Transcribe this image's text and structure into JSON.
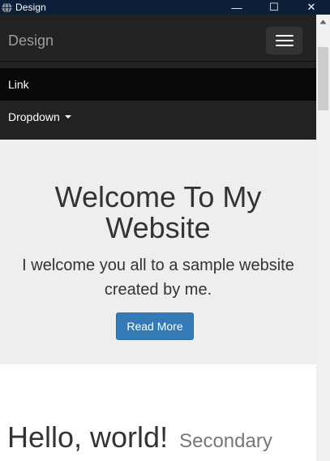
{
  "window": {
    "title": "Design",
    "controls": {
      "minimize": "—",
      "maximize": "☐",
      "close": "✕"
    }
  },
  "navbar": {
    "brand": "Design",
    "items": [
      {
        "label": "Link"
      },
      {
        "label": "Dropdown"
      }
    ]
  },
  "jumbotron": {
    "title": "Welcome To My Website",
    "text": "I welcome you all to a sample website created by me.",
    "button_label": "Read More"
  },
  "content": {
    "heading": "Hello, world!",
    "secondary": "Secondary"
  },
  "colors": {
    "titlebar": "#0b1f39",
    "navbar": "#222222",
    "active_nav": "#080808",
    "jumbotron": "#eeeeee",
    "primary_button": "#337ab7"
  }
}
